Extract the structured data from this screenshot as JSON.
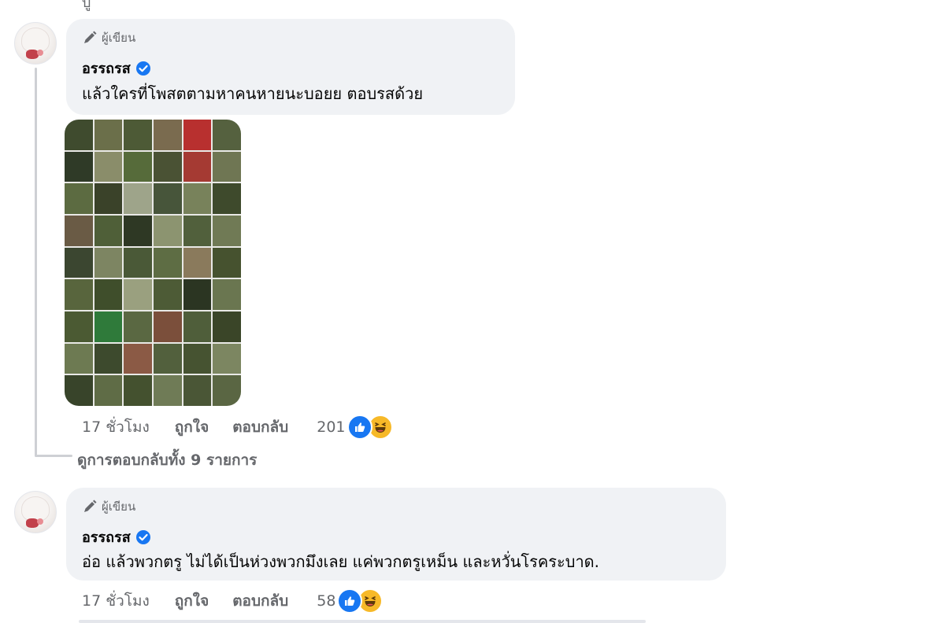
{
  "top_fragment": "บู",
  "comments": [
    {
      "author_badge": "ผู้เขียน",
      "author_name": "อรรถรส",
      "text": "แล้วใครที่โพสตตามหาคนหายนะบอยย ตอบรสด้วย",
      "time": "17 ชั่วโมง",
      "like_label": "ถูกใจ",
      "reply_label": "ตอบกลับ",
      "reaction_count": "201",
      "reactions": [
        "like-icon",
        "haha-icon"
      ],
      "has_photo": true
    },
    {
      "author_badge": "ผู้เขียน",
      "author_name": "อรรถรส",
      "text": "อ่อ แล้วพวกตรู ไม่ได้เป็นห่วงพวกมึงเลย แค่พวกตรูเหม็น และหวั่นโรคระบาด.",
      "time": "17 ชั่วโมง",
      "like_label": "ถูกใจ",
      "reply_label": "ตอบกลับ",
      "reaction_count": "58",
      "reactions": [
        "like-icon",
        "haha-icon"
      ],
      "has_photo": false
    }
  ],
  "view_replies": "ดูการตอบกลับทั้ง 9 รายการ",
  "colors": {
    "bubble": "#f0f2f5",
    "secondary_text": "#65676b",
    "verified": "#1877f2",
    "like": "#1877f2",
    "haha": "#f7b928"
  }
}
